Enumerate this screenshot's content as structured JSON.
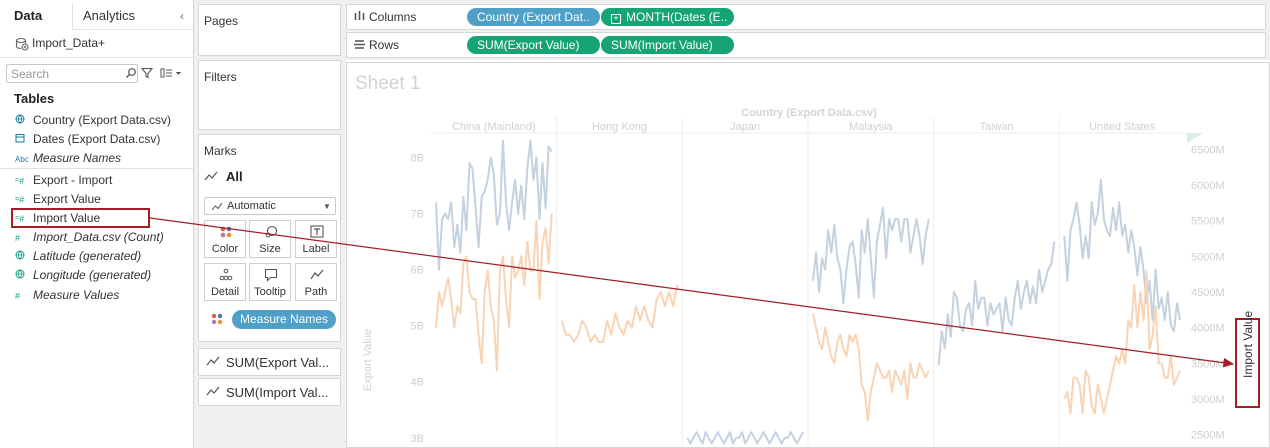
{
  "data_pane": {
    "tabs": [
      "Data",
      "Analytics"
    ],
    "datasource": "Import_Data+",
    "search_placeholder": "Search",
    "tables_heading": "Tables",
    "fields": [
      {
        "name": "Country (Export Data.csv)",
        "icon": "globe-icon",
        "kind": "dimension",
        "italic": false
      },
      {
        "name": "Dates (Export Data.csv)",
        "icon": "calendar-icon",
        "kind": "dimension",
        "italic": false
      },
      {
        "name": "Measure Names",
        "icon": "abc-icon",
        "kind": "dimension",
        "italic": true,
        "icon_text": "Abc"
      },
      {
        "name": "Export - Import",
        "icon": "measure-calc-icon",
        "kind": "measure",
        "italic": false
      },
      {
        "name": "Export Value",
        "icon": "measure-icon",
        "kind": "measure",
        "italic": false
      },
      {
        "name": "Import Value",
        "icon": "measure-icon",
        "kind": "measure",
        "italic": false,
        "highlighted": true
      },
      {
        "name": "Import_Data.csv (Count)",
        "icon": "hash-icon",
        "kind": "measure",
        "italic": true
      },
      {
        "name": "Latitude (generated)",
        "icon": "globe-icon",
        "kind": "measure",
        "italic": true
      },
      {
        "name": "Longitude (generated)",
        "icon": "globe-icon",
        "kind": "measure",
        "italic": true
      },
      {
        "name": "Measure Values",
        "icon": "hash-icon",
        "kind": "measure",
        "italic": true
      }
    ]
  },
  "cards": {
    "pages": "Pages",
    "filters": "Filters",
    "marks": {
      "title": "Marks",
      "all_label": "All",
      "mark_type": "Automatic",
      "buttons": [
        "Color",
        "Size",
        "Label",
        "Detail",
        "Tooltip",
        "Path"
      ],
      "color_pill": "Measure Names",
      "sub_cards": [
        "SUM(Export Val...",
        "SUM(Import Val..."
      ]
    }
  },
  "shelves": {
    "columns_label": "Columns",
    "rows_label": "Rows",
    "columns_pills": [
      "Country (Export Dat..",
      "MONTH(Dates (E.."
    ],
    "rows_pills": [
      "SUM(Export Value)",
      "SUM(Import Value)"
    ]
  },
  "sheet": {
    "title": "Sheet 1",
    "import_axis_title": "Import Value"
  },
  "chart_data": {
    "type": "line",
    "title": "Sheet 1",
    "header_title": "Country (Export Data.csv)",
    "categories": [
      "China (Mainland)",
      "Hong Kong",
      "Japan",
      "Malaysia",
      "Taiwan",
      "United States"
    ],
    "ylabel": "Export Value",
    "y2label": "Import Value",
    "y_ticks": [
      "8B",
      "7B",
      "6B",
      "5B",
      "4B",
      "3B"
    ],
    "y2_ticks": [
      "6500M",
      "6000M",
      "5500M",
      "5000M",
      "4500M",
      "4000M",
      "3500M",
      "3000M",
      "2500M"
    ],
    "ylim": [
      2.8,
      8.4
    ],
    "y2lim": [
      2300,
      6700
    ],
    "series": [
      {
        "name": "SUM(Export Value)",
        "color": "#c3d1e0",
        "panes": [
          [
            7.2,
            6.0,
            6.9,
            7.0,
            6.9,
            7.2,
            6.4,
            6.8,
            6.3,
            7.3,
            6.7,
            7.9,
            7.8,
            7.1,
            6.4,
            7.3,
            7.4,
            7.6,
            8.0,
            7.7,
            6.8,
            7.0,
            8.3,
            7.2,
            6.7,
            7.2,
            7.6,
            7.0,
            7.5,
            6.9,
            7.8,
            8.3,
            7.6,
            8.0,
            6.9,
            7.9,
            7.1,
            8.2,
            8.1
          ],
          [],
          [
            3.0,
            2.9,
            3.0,
            3.1,
            3.0,
            2.9,
            3.1,
            3.0,
            2.9,
            3.0,
            3.1,
            3.0,
            2.9,
            3.0,
            3.1,
            2.9,
            3.0,
            3.0,
            3.1,
            2.9,
            3.0,
            3.1,
            3.0,
            2.9,
            3.0,
            3.1,
            3.0,
            2.9,
            3.0,
            3.1,
            3.0,
            2.9,
            3.0,
            3.0,
            3.1,
            3.0,
            2.9,
            3.0,
            3.1
          ],
          [
            5.8,
            6.3,
            5.6,
            6.2,
            6.0,
            6.7,
            6.3,
            6.8,
            6.2,
            6.0,
            5.4,
            6.0,
            6.4,
            6.5,
            6.1,
            5.5,
            6.7,
            6.3,
            6.9,
            6.2,
            5.5,
            6.5,
            6.8,
            7.1,
            6.2,
            6.9,
            6.7,
            6.9,
            6.9,
            6.5,
            6.9,
            6.9,
            6.3,
            6.6,
            6.9,
            6.6,
            6.1,
            6.6,
            6.9
          ],
          [
            4.3,
            4.9,
            4.6,
            5.2,
            4.8,
            5.6,
            5.5,
            5.0,
            4.9,
            5.3,
            5.4,
            5.0,
            5.8,
            5.3,
            5.5,
            5.5,
            5.0,
            5.4,
            5.2,
            5.3,
            5.4,
            4.9,
            5.5,
            5.1,
            5.0,
            5.5,
            5.8,
            5.3,
            5.6,
            5.8,
            5.4,
            5.7,
            5.4,
            6.0,
            5.6,
            5.8,
            6.0,
            6.1,
            6.5
          ],
          [
            6.6,
            5.8,
            6.7,
            6.9,
            7.2,
            6.8,
            6.2,
            6.6,
            6.2,
            7.2,
            6.8,
            7.0,
            7.6,
            6.9,
            6.7,
            6.6,
            7.1,
            6.7,
            7.2,
            6.6,
            6.8,
            6.3,
            6.7,
            6.4,
            5.9,
            6.4,
            6.0,
            5.4,
            5.8,
            5.1,
            6.0,
            5.3,
            5.5,
            5.1,
            5.6,
            5.0,
            4.9,
            5.4,
            5.1
          ]
        ]
      },
      {
        "name": "SUM(Import Value)",
        "color": "#f9d3b3",
        "panes": [
          [
            4000,
            4500,
            4300,
            4500,
            4700,
            4400,
            4000,
            4300,
            4200,
            4900,
            5000,
            4500,
            4400,
            4400,
            3900,
            3500,
            4500,
            4800,
            4300,
            4100,
            3400,
            4800,
            5000,
            4400,
            4000,
            5000,
            4700,
            4800,
            5000,
            4600,
            5200,
            4800,
            4800,
            5500,
            4400,
            5200,
            5400,
            4900,
            5600
          ],
          [
            4100,
            3900,
            3900,
            3800,
            3900,
            4100,
            4000,
            3800,
            3900,
            3800,
            3800,
            4100,
            3900,
            4200,
            4000,
            3900,
            4100,
            4000,
            4300,
            4100,
            4300,
            4100,
            4000,
            4400,
            4500,
            4300,
            4500,
            4300,
            4600
          ],
          [],
          [
            4200,
            4000,
            3800,
            3700,
            4000,
            3800,
            3600,
            3500,
            3800,
            3900,
            3700,
            3600,
            3900,
            3800,
            3900,
            3700,
            3200,
            3100,
            2700,
            3100,
            3300,
            3500,
            3400,
            3300,
            3300,
            3400,
            3100,
            3400,
            3300,
            3200,
            3400,
            3000,
            3500,
            3300,
            3300,
            3500,
            3400,
            3300,
            3400
          ],
          [],
          [
            3000,
            3100,
            2800,
            3300,
            3300,
            3200,
            2800,
            3400,
            3300,
            2900,
            2800,
            3200,
            3000,
            2800,
            3000,
            3200,
            3400,
            3600,
            3500,
            3700,
            3500,
            4100,
            4000,
            4600,
            4000,
            4500,
            4100,
            4800,
            3700,
            3900,
            4300,
            3500,
            3500,
            3300,
            3300,
            3600,
            3200,
            3300,
            3400
          ]
        ]
      }
    ]
  }
}
